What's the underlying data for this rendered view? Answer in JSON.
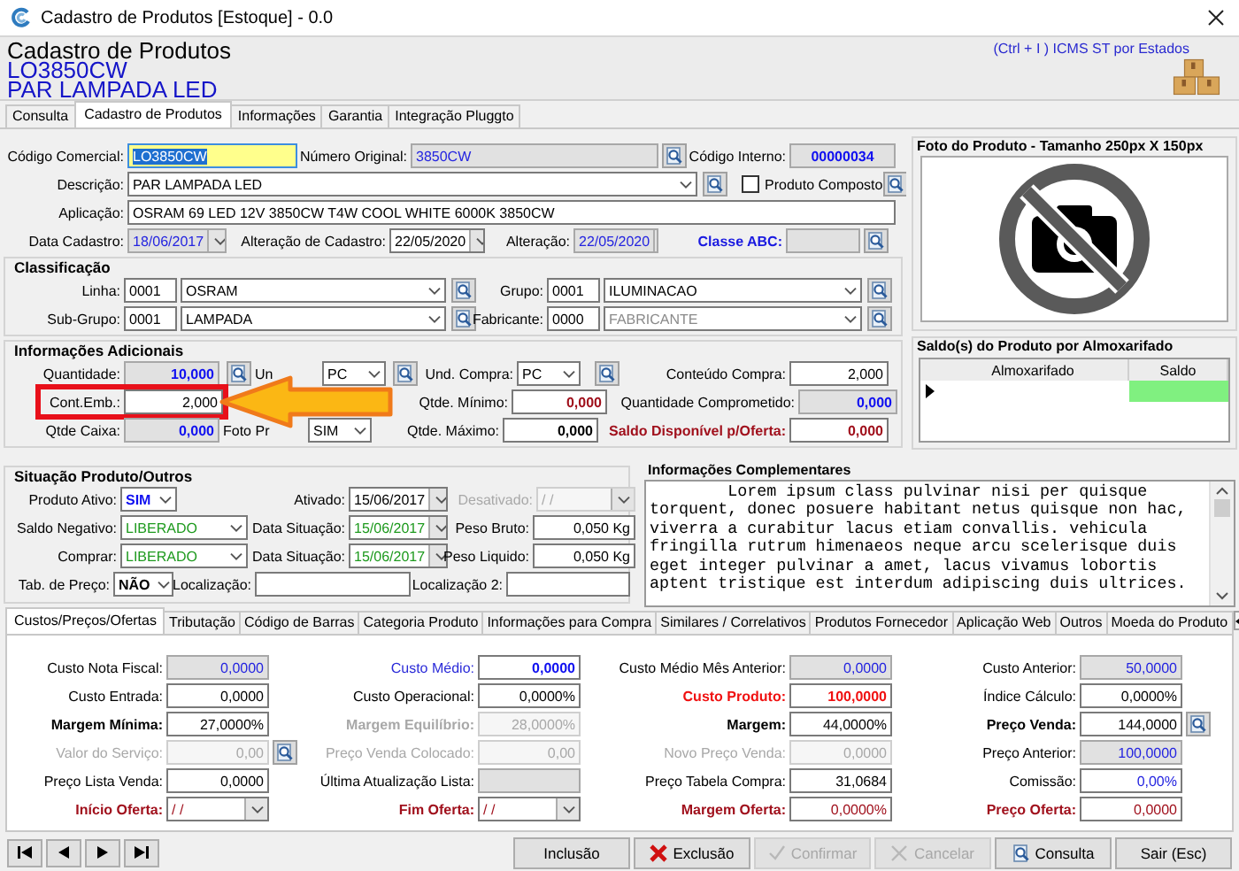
{
  "window": {
    "title": "Cadastro de Produtos [Estoque] - 0.0"
  },
  "header": {
    "title": "Cadastro de Produtos",
    "code": "LO3850CW",
    "description": "PAR LAMPADA LED",
    "shortcut": "(Ctrl + I ) ICMS ST por Estados"
  },
  "tabs": [
    {
      "label": "Consulta",
      "selected": false
    },
    {
      "label": "Cadastro de Produtos",
      "selected": true
    },
    {
      "label": "Informações",
      "selected": false
    },
    {
      "label": "Garantia",
      "selected": false
    },
    {
      "label": "Integração Pluggto",
      "selected": false
    }
  ],
  "identificacao": {
    "codigo_comercial": {
      "label": "Código Comercial:",
      "value": "LO3850CW",
      "kind": "text",
      "focused": true
    },
    "numero_original": {
      "label": "Número Original:",
      "value": "3850CW",
      "kind": "text",
      "readonly": true,
      "color": "#2424e0"
    },
    "codigo_interno": {
      "label": "Código Interno:",
      "value": "00000034",
      "kind": "text",
      "readonly": true,
      "color": "#1010f0",
      "bold": true
    },
    "descricao": {
      "label": "Descrição:",
      "value": "PAR LAMPADA LED",
      "kind": "combo"
    },
    "produto_composto": {
      "label": "Produto Composto",
      "checked": false
    },
    "aplicacao": {
      "label": "Aplicação:",
      "value": "OSRAM 69 LED 12V 3850CW T4W COOL WHITE 6000K 3850CW",
      "kind": "text"
    },
    "data_cadastro": {
      "label": "Data Cadastro:",
      "value": "18/06/2017",
      "kind": "date",
      "readonly": true,
      "color": "#2424e0"
    },
    "alteracao_cadastro": {
      "label": "Alteração de Cadastro:",
      "value": "22/05/2020",
      "kind": "date"
    },
    "alteracao": {
      "label": "Alteração:",
      "value": "22/05/2020",
      "kind": "date",
      "readonly": true,
      "color": "#2424e0"
    },
    "classe_abc": {
      "label": {
        "text": "Classe ABC:",
        "color": "#1a1ae0"
      },
      "kind": "text",
      "readonly": true,
      "label_bold": true
    }
  },
  "classificacao": {
    "title": "Classificação",
    "linha": {
      "label": "Linha:",
      "code": "0001",
      "value": "OSRAM",
      "kind": "combo"
    },
    "grupo": {
      "label": "Grupo:",
      "code": "0001",
      "value": "ILUMINACAO",
      "kind": "combo"
    },
    "sub_grupo": {
      "label": "Sub-Grupo:",
      "code": "0001",
      "value": "LAMPADA",
      "kind": "combo"
    },
    "fabricante": {
      "label": "Fabricante:",
      "code": "0000",
      "value": "FABRICANTE",
      "kind": "combo",
      "color": "#8a8a8a"
    }
  },
  "informacoes_adicionais": {
    "title": "Informações Adicionais",
    "quantidade": {
      "label": "Quantidade:",
      "value": "10,000",
      "kind": "number",
      "readonly": true,
      "color": "#1010f0",
      "bold": true
    },
    "und_venda": {
      "label": "Un",
      "value": "PC",
      "kind": "combo"
    },
    "und_compra": {
      "label": "Und. Compra:",
      "value": "PC",
      "kind": "combo"
    },
    "conteudo_compra": {
      "label": "Conteúdo Compra:",
      "value": "2,000",
      "kind": "number"
    },
    "cont_emb": {
      "label": "Cont.Emb.:",
      "value": "2,000",
      "kind": "number"
    },
    "qtde_minimo": {
      "label": "Qtde. Mínimo:",
      "value": "0,000",
      "kind": "number",
      "color": "#a0101c",
      "bold": true
    },
    "quantidade_comprometido": {
      "label": "Quantidade Comprometido:",
      "value": "0,000",
      "kind": "number",
      "readonly": true,
      "color": "#1010f0",
      "bold": true
    },
    "qtde_caixa": {
      "label": "Qtde Caixa:",
      "value": "0,000",
      "kind": "number",
      "readonly": true,
      "color": "#1010f0",
      "bold": true
    },
    "foto_produto": {
      "label": "Foto Pr",
      "value": "SIM",
      "kind": "combo"
    },
    "qtde_maximo": {
      "label": "Qtde. Máximo:",
      "value": "0,000",
      "kind": "number",
      "bold": true
    },
    "saldo_disponivel": {
      "label": {
        "text": "Saldo Disponível p/Oferta:",
        "color": "#a0101c"
      },
      "value": "0,000",
      "kind": "number",
      "label_bold": true,
      "color": "#a0101c",
      "bold": true
    }
  },
  "foto": {
    "title": "Foto do Produto - Tamanho 250px X 150px"
  },
  "saldos": {
    "title": "Saldo(s) do Produto por Almoxarifado",
    "columns": [
      "Almoxarifado",
      "Saldo"
    ],
    "rows": [
      {
        "current": true
      }
    ]
  },
  "situacao": {
    "title": "Situação Produto/Outros",
    "produto_ativo": {
      "label": "Produto Ativo:",
      "value": "SIM",
      "kind": "combo",
      "color": "#1010f0",
      "bold": true
    },
    "ativado": {
      "label": "Ativado:",
      "value": "15/06/2017",
      "kind": "date"
    },
    "desativado": {
      "label": "Desativado:",
      "value": "/ /",
      "kind": "date",
      "disabled": true
    },
    "saldo_negativo": {
      "label": "Saldo Negativo:",
      "value": "LIBERADO",
      "kind": "combo",
      "color": "#1e9a1e"
    },
    "data_situacao_saldo": {
      "label": "Data Situação:",
      "value": "15/06/2017",
      "kind": "date",
      "color": "#1e9a1e"
    },
    "peso_bruto": {
      "label": "Peso Bruto:",
      "value": "0,050 Kg",
      "kind": "number"
    },
    "comprar": {
      "label": "Comprar:",
      "value": "LIBERADO",
      "kind": "combo",
      "color": "#1e9a1e"
    },
    "data_situacao_comprar": {
      "label": "Data Situação:",
      "value": "15/06/2017",
      "kind": "date",
      "color": "#1e9a1e"
    },
    "peso_liquido": {
      "label": "Peso Liquido:",
      "value": "0,050 Kg",
      "kind": "number"
    },
    "tab_preco": {
      "label": "Tab. de Preço:",
      "value": "NÃO",
      "kind": "combo",
      "bold": true
    },
    "localizacao": {
      "label": "Localização:",
      "kind": "text"
    },
    "localizacao_2": {
      "label": "Localização 2:",
      "kind": "text"
    }
  },
  "informacoes_complementares": {
    "title": "Informações Complementares",
    "text": "Lorem ipsum class pulvinar nisi per quisque torquent, donec posuere habitant netus quisque non hac, viverra a curabitur lacus etiam convallis. vehicula fringilla rutrum himenaeos neque arcu scelerisque duis eget integer pulvinar a amet, lacus vivamus lobortis aptent tristique est interdum adipiscing duis ultrices."
  },
  "detail_tabs": [
    {
      "label": "Custos/Preços/Ofertas",
      "selected": true
    },
    {
      "label": "Tributação",
      "selected": false
    },
    {
      "label": "Código de Barras",
      "selected": false
    },
    {
      "label": "Categoria Produto",
      "selected": false
    },
    {
      "label": "Informações para Compra",
      "selected": false
    },
    {
      "label": "Similares / Correlativos",
      "selected": false
    },
    {
      "label": "Produtos Fornecedor",
      "selected": false
    },
    {
      "label": "Aplicação Web",
      "selected": false
    },
    {
      "label": "Outros",
      "selected": false
    },
    {
      "label": "Moeda do Produto",
      "selected": false
    }
  ],
  "custos": [
    [
      {
        "label": "Custo Nota Fiscal:",
        "value": "0,0000",
        "kind": "number",
        "readonly": true,
        "color": "#2424e0"
      },
      {
        "label": {
          "text": "Custo Médio:",
          "color": "#2a2ad8"
        },
        "value": "0,0000",
        "kind": "number",
        "color": "#1010f0",
        "bold": true
      },
      {
        "label": "Custo Médio Mês Anterior:",
        "value": "0,0000",
        "kind": "number",
        "readonly": true,
        "color": "#2424e0"
      },
      {
        "label": "Custo Anterior:",
        "value": "50,0000",
        "kind": "number",
        "readonly": true,
        "color": "#2424e0"
      }
    ],
    [
      {
        "label": "Custo Entrada:",
        "value": "0,0000",
        "kind": "number"
      },
      {
        "label": "Custo Operacional:",
        "value": "0,0000%",
        "kind": "number"
      },
      {
        "label": {
          "text": "Custo Produto:",
          "color": "#f01010"
        },
        "value": "100,0000",
        "kind": "number",
        "color": "#f01010",
        "bold": true,
        "label_bold": true
      },
      {
        "label": "Índice Cálculo:",
        "value": "0,0000%",
        "kind": "number"
      }
    ],
    [
      {
        "label": "Margem Mínima:",
        "value": "27,0000%",
        "kind": "number",
        "label_bold": true
      },
      {
        "label": "Margem Equilíbrio:",
        "value": "28,0000%",
        "kind": "number",
        "label_bold": true,
        "disabled": true
      },
      {
        "label": "Margem:",
        "value": "44,0000%",
        "kind": "number",
        "label_bold": true
      },
      {
        "label": "Preço Venda:",
        "value": "144,0000",
        "kind": "number",
        "label_bold": true,
        "lookup": true
      }
    ],
    [
      {
        "label": "Valor do Serviço:",
        "value": "0,00",
        "kind": "number",
        "disabled": true,
        "lookup": true
      },
      {
        "label": "Preço Venda Colocado:",
        "value": "0,00",
        "kind": "number",
        "disabled": true
      },
      {
        "label": "Novo Preço Venda:",
        "value": "0,0000",
        "kind": "number",
        "disabled": true
      },
      {
        "label": "Preço Anterior:",
        "value": "100,0000",
        "kind": "number",
        "readonly": true,
        "color": "#2424e0"
      }
    ],
    [
      {
        "label": "Preço Lista Venda:",
        "value": "0,0000",
        "kind": "number"
      },
      {
        "label": "Última Atualização Lista:",
        "kind": "text",
        "readonly": true
      },
      {
        "label": "Preço Tabela Compra:",
        "value": "31,0684",
        "kind": "number"
      },
      {
        "label": "Comissão:",
        "value": "0,00%",
        "kind": "number",
        "color": "#2424e0"
      }
    ],
    [
      {
        "label": {
          "text": "Início Oferta:",
          "color": "#a0101c"
        },
        "value": "/ /",
        "kind": "date",
        "color": "#a0101c",
        "label_bold": true
      },
      {
        "label": {
          "text": "Fim Oferta:",
          "color": "#a0101c"
        },
        "value": "/ /",
        "kind": "date",
        "color": "#a0101c",
        "label_bold": true
      },
      {
        "label": {
          "text": "Margem Oferta:",
          "color": "#a0101c"
        },
        "value": "0,0000%",
        "kind": "number",
        "color": "#a0101c",
        "label_bold": true
      },
      {
        "label": {
          "text": "Preço Oferta:",
          "color": "#a0101c"
        },
        "value": "0,0000",
        "kind": "number",
        "color": "#a0101c",
        "label_bold": true
      }
    ]
  ],
  "actions": [
    {
      "label": "Inclusão",
      "kind": "plain",
      "disabled": false
    },
    {
      "label": "Exclusão",
      "kind": "delete",
      "disabled": false
    },
    {
      "label": "Confirmar",
      "kind": "confirm",
      "disabled": true
    },
    {
      "label": "Cancelar",
      "kind": "cancel",
      "disabled": true
    },
    {
      "label": "Consulta",
      "kind": "search",
      "disabled": false
    },
    {
      "label": "Sair (Esc)",
      "kind": "plain",
      "disabled": false
    }
  ]
}
